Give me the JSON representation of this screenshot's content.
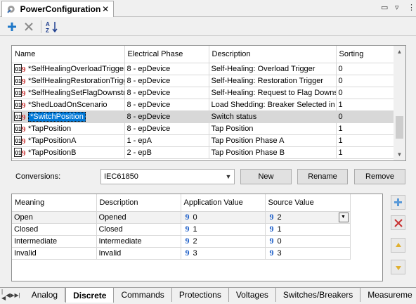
{
  "title_tab": {
    "label": "PowerConfiguration",
    "close": "✕"
  },
  "window_controls": {
    "restore": "▭",
    "dropdown": "▿",
    "more": "⋮"
  },
  "toolbar": {
    "add_icon": "plus-icon",
    "delete_icon": "close-icon",
    "sort_icon": "sort-az-icon"
  },
  "signals_table": {
    "columns": [
      "Name",
      "Electrical Phase",
      "Description",
      "Sorting"
    ],
    "rows": [
      {
        "name": "*SelfHealingOverloadTrigger",
        "phase": "8 - epDevice",
        "description": "Self-Healing: Overload Trigger",
        "sorting": "0"
      },
      {
        "name": "*SelfHealingRestorationTrigg",
        "phase": "8 - epDevice",
        "description": "Self-Healing: Restoration Trigger",
        "sorting": "0"
      },
      {
        "name": "*SelfHealingSetFlagDownstre",
        "phase": "8 - epDevice",
        "description": "Self-Healing: Request to Flag Downs",
        "sorting": "0"
      },
      {
        "name": "*ShedLoadOnScenario",
        "phase": "8 - epDevice",
        "description": "Load Shedding: Breaker Selected in S",
        "sorting": "1"
      },
      {
        "name": "*SwitchPosition",
        "phase": "8 - epDevice",
        "description": "Switch status",
        "sorting": "0"
      },
      {
        "name": "*TapPosition",
        "phase": "8 - epDevice",
        "description": "Tap Position",
        "sorting": "1"
      },
      {
        "name": "*TapPositionA",
        "phase": "1 - epA",
        "description": "Tap Position Phase A",
        "sorting": "1"
      },
      {
        "name": "*TapPositionB",
        "phase": "2 - epB",
        "description": "Tap Position Phase B",
        "sorting": "1"
      }
    ],
    "selected_index": 4
  },
  "conversions": {
    "label": "Conversions:",
    "selected": "IEC61850",
    "new_button": "New",
    "rename_button": "Rename",
    "remove_button": "Remove"
  },
  "mapping_table": {
    "columns": [
      "Meaning",
      "Description",
      "Application Value",
      "Source Value"
    ],
    "rows": [
      {
        "meaning": "Open",
        "description": "Opened",
        "app_value": "0",
        "source_value": "2"
      },
      {
        "meaning": "Closed",
        "description": "Closed",
        "app_value": "1",
        "source_value": "1"
      },
      {
        "meaning": "Intermediate",
        "description": "Intermediate",
        "app_value": "2",
        "source_value": "0"
      },
      {
        "meaning": "Invalid",
        "description": "Invalid",
        "app_value": "3",
        "source_value": "3"
      }
    ],
    "num_glyph": "9"
  },
  "bottom_tabs": {
    "tabs": [
      "Analog",
      "Discrete",
      "Commands",
      "Protections",
      "Voltages",
      "Switches/Breakers",
      "Measureme"
    ],
    "active": "Discrete"
  },
  "colors": {
    "accent": "#0078d7",
    "selection_gray": "#d8d8d8",
    "add_blue": "#1f78c8",
    "remove_red": "#c83232",
    "arrow_yellow": "#e0b030"
  }
}
